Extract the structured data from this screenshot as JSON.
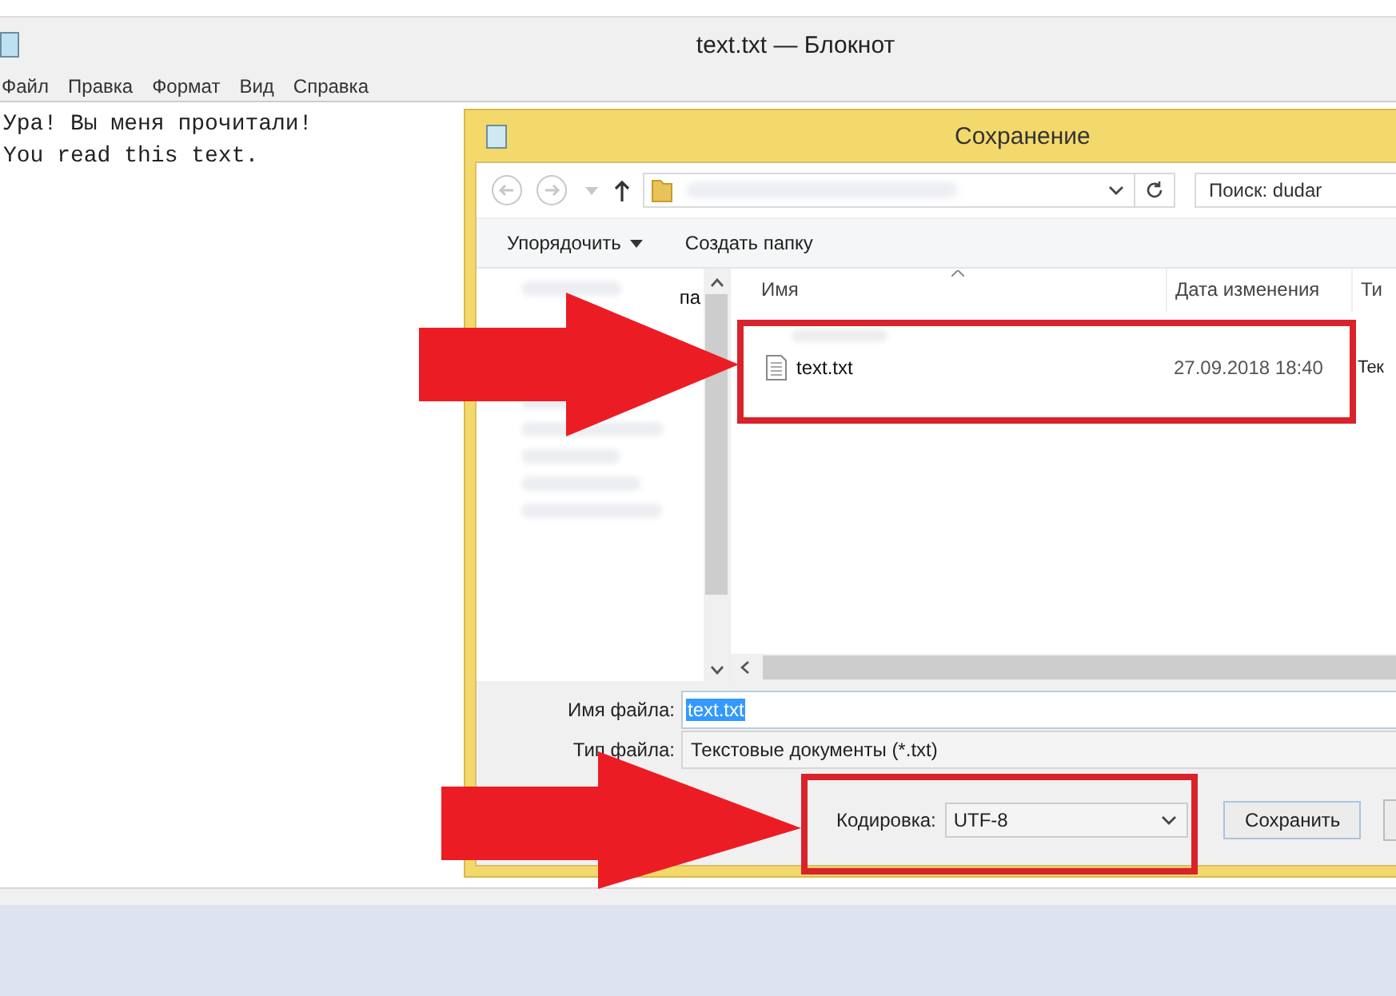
{
  "notepad": {
    "title": "text.txt — Блокнот",
    "menu": [
      "Файл",
      "Правка",
      "Формат",
      "Вид",
      "Справка"
    ],
    "lines": [
      "Ура! Вы меня прочитали!",
      "You read this text."
    ]
  },
  "dialog": {
    "title": "Сохранение",
    "search": {
      "placeholder": "Поиск: dudar"
    },
    "commands": [
      {
        "label": "Упорядочить",
        "kind": "menu"
      },
      {
        "label": "Создать папку",
        "kind": "plain"
      }
    ],
    "sidebar_fragment": "па",
    "columns": [
      "Имя",
      "Дата изменения",
      "Ти"
    ],
    "files": [
      {
        "name": "text.txt",
        "date": "27.09.2018 18:40",
        "type": "Тек"
      }
    ],
    "filename": {
      "label": "Имя файла:",
      "value": "text.txt"
    },
    "filetype": {
      "label": "Тип файла:",
      "value": "Текстовые документы (*.txt)"
    },
    "encoding": {
      "label": "Кодировка:",
      "value": "UTF-8"
    },
    "buttons": [
      "Сохранить"
    ]
  }
}
